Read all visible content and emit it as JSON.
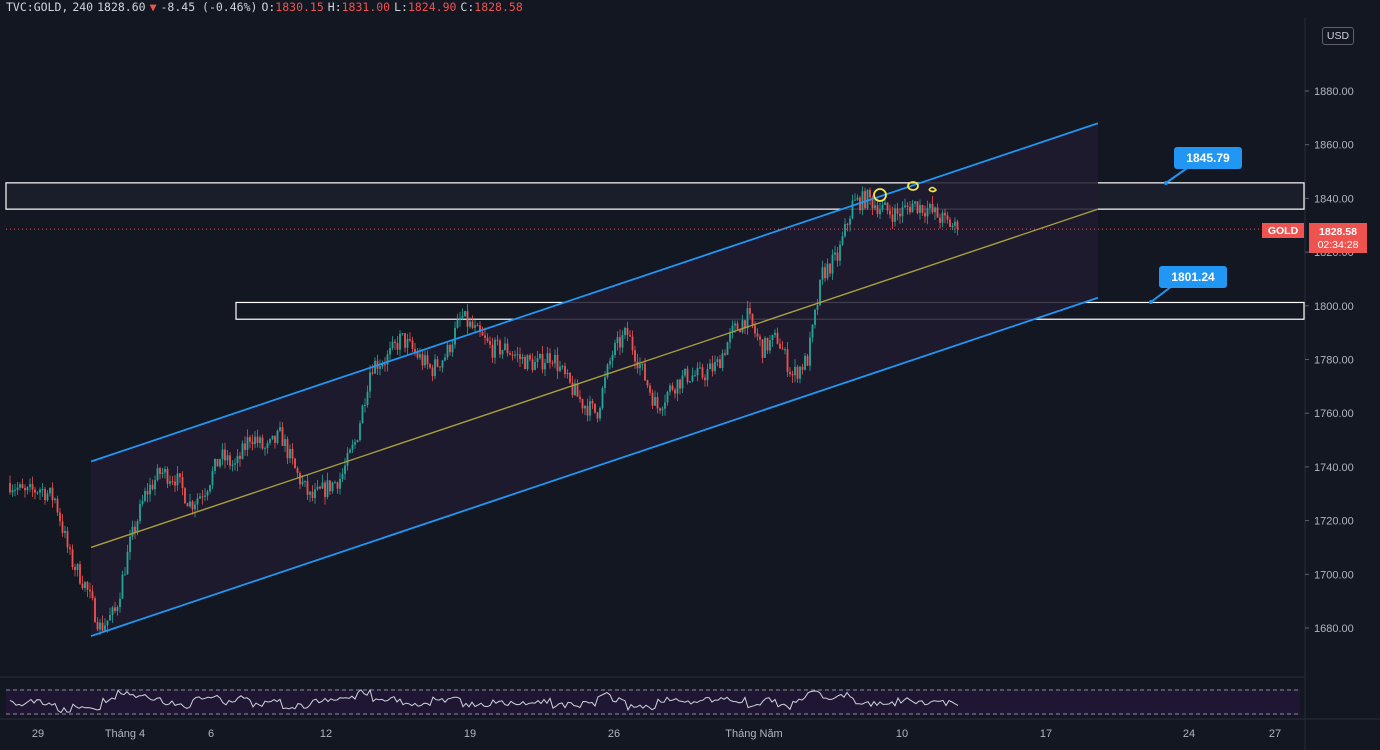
{
  "header": {
    "symbol": "TVC:GOLD,",
    "interval": "240",
    "last": "1828.60",
    "change": "-8.45 (-0.46%)",
    "open_label": "O:",
    "open": "1830.15",
    "high_label": "H:",
    "high": "1831.00",
    "low_label": "L:",
    "low": "1824.90",
    "close_label": "C:",
    "close": "1828.58"
  },
  "currency": "USD",
  "price_tag": {
    "symbol": "GOLD",
    "price": "1828.58",
    "countdown": "02:34:28"
  },
  "callouts": {
    "upper": "1845.79",
    "lower": "1801.24"
  },
  "colors": {
    "background": "#131722",
    "up_candle": "#26a69a",
    "down_candle": "#ef5350",
    "channel": "#2196f3",
    "midline": "#a8a13c",
    "callout": "#2196f3",
    "price_tag": "#ef5350",
    "highlight_marks": "#f5e44b"
  },
  "chart_data": {
    "type": "candlestick",
    "symbol": "TVC:GOLD",
    "interval": "240",
    "y_axis": {
      "min": 1670,
      "max": 1900,
      "ticks": [
        1680,
        1700,
        1720,
        1740,
        1760,
        1780,
        1800,
        1820,
        1840,
        1860,
        1880
      ],
      "tick_labels": [
        "1680.00",
        "1700.00",
        "1720.00",
        "1740.00",
        "1760.00",
        "1780.00",
        "1800.00",
        "1820.00",
        "1840.00",
        "1860.00",
        "1880.00"
      ]
    },
    "x_axis": {
      "labels": [
        "29",
        "Tháng 4",
        "6",
        "12",
        "19",
        "26",
        "Tháng Năm",
        "10",
        "17",
        "24",
        "27"
      ]
    },
    "close_path": [
      1734,
      1730,
      1732,
      1728,
      1706,
      1696,
      1680,
      1686,
      1712,
      1730,
      1738,
      1736,
      1726,
      1732,
      1744,
      1740,
      1752,
      1746,
      1752,
      1738,
      1728,
      1732,
      1736,
      1750,
      1778,
      1780,
      1788,
      1782,
      1776,
      1782,
      1796,
      1790,
      1784,
      1784,
      1780,
      1778,
      1782,
      1772,
      1764,
      1760,
      1782,
      1790,
      1776,
      1762,
      1770,
      1774,
      1774,
      1778,
      1790,
      1796,
      1784,
      1788,
      1774,
      1780,
      1812,
      1818,
      1838,
      1840,
      1836,
      1834,
      1838,
      1836,
      1832,
      1828.58
    ],
    "channel": {
      "upper": {
        "start_value": 1742,
        "end_value": 1868
      },
      "middle": {
        "start_value": 1710,
        "end_value": 1836
      },
      "lower": {
        "start_value": 1677,
        "end_value": 1803
      }
    },
    "zones": [
      {
        "from": 1836,
        "to": 1845.79
      },
      {
        "from": 1795,
        "to": 1801.24
      }
    ],
    "current_price": 1828.58
  }
}
